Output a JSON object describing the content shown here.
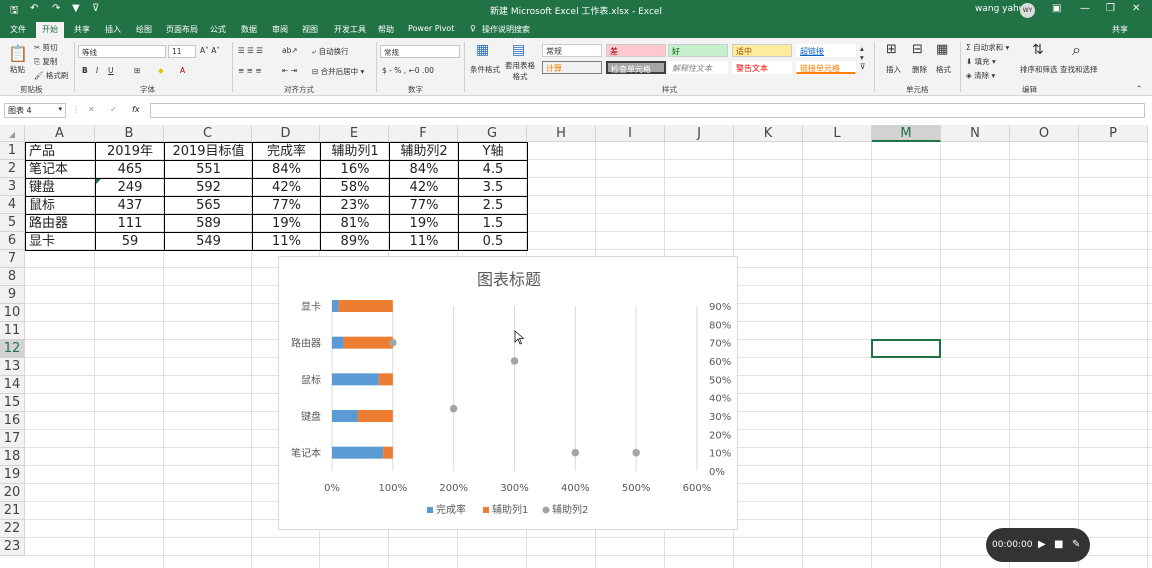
{
  "window": {
    "title": "新建 Microsoft Excel 工作表.xlsx  -  Excel",
    "user": "wang yahui",
    "avatar": "WY"
  },
  "tabs": [
    "文件",
    "开始",
    "共享",
    "插入",
    "绘图",
    "页面布局",
    "公式",
    "数据",
    "审阅",
    "视图",
    "开发工具",
    "帮助",
    "Power Pivot",
    "操作说明搜索"
  ],
  "share_label": "共享",
  "ribbon": {
    "clipboard": {
      "paste": "粘贴",
      "cut": "剪切",
      "copy": "复制",
      "painter": "格式刷",
      "label": "剪贴板"
    },
    "font": {
      "name": "等线",
      "size": "11",
      "label": "字体"
    },
    "align": {
      "wrap": "自动换行",
      "merge": "合并后居中",
      "label": "对齐方式"
    },
    "number": {
      "format": "常规",
      "label": "数字"
    },
    "styles": {
      "cond": "条件格式",
      "table": "套用表格格式",
      "items": [
        "常规",
        "差",
        "好",
        "适中",
        "超链接",
        "计算",
        "检查单元格",
        "解释性文本",
        "警告文本",
        "链接单元格"
      ],
      "label": "样式"
    },
    "cells": {
      "insert": "插入",
      "delete": "删除",
      "format": "格式",
      "label": "单元格"
    },
    "edit": {
      "autosum": "自动求和",
      "fill": "填充",
      "clear": "清除",
      "sort": "排序和筛选",
      "find": "查找和选择",
      "label": "编辑"
    }
  },
  "namebox": "图表 4",
  "columns": [
    "A",
    "B",
    "C",
    "D",
    "E",
    "F",
    "G",
    "H",
    "I",
    "J",
    "K",
    "L",
    "M",
    "N",
    "O",
    "P"
  ],
  "rows": [
    "1",
    "2",
    "3",
    "4",
    "5",
    "6",
    "7",
    "8",
    "9",
    "10",
    "11",
    "12",
    "13",
    "14",
    "15",
    "16",
    "17",
    "18",
    "19",
    "20",
    "21",
    "22",
    "23"
  ],
  "table": [
    [
      "产品",
      "2019年",
      "2019目标值",
      "完成率",
      "辅助列1",
      "辅助列2",
      "Y轴"
    ],
    [
      "笔记本",
      "465",
      "551",
      "84%",
      "16%",
      "84%",
      "4.5"
    ],
    [
      "键盘",
      "249",
      "592",
      "42%",
      "58%",
      "42%",
      "3.5"
    ],
    [
      "鼠标",
      "437",
      "565",
      "77%",
      "23%",
      "77%",
      "2.5"
    ],
    [
      "路由器",
      "111",
      "589",
      "19%",
      "81%",
      "19%",
      "1.5"
    ],
    [
      "显卡",
      "59",
      "549",
      "11%",
      "89%",
      "11%",
      "0.5"
    ]
  ],
  "chart_data": {
    "type": "bar",
    "title": "图表标题",
    "categories": [
      "笔记本",
      "键盘",
      "鼠标",
      "路由器",
      "显卡"
    ],
    "series": [
      {
        "name": "完成率",
        "values": [
          84,
          42,
          77,
          19,
          11
        ],
        "color": "#5b9bd5"
      },
      {
        "name": "辅助列1",
        "values": [
          16,
          58,
          23,
          81,
          89
        ],
        "color": "#ed7d31"
      }
    ],
    "scatter": {
      "name": "辅助列2",
      "x": [
        500,
        400,
        200,
        300,
        100
      ],
      "y": [
        0.5,
        0.5,
        1.7,
        3.0,
        3.5
      ],
      "color": "#a5a5a5"
    },
    "x_ticks": [
      "0%",
      "100%",
      "200%",
      "300%",
      "400%",
      "500%",
      "600%"
    ],
    "y2_ticks": [
      "0%",
      "10%",
      "20%",
      "30%",
      "40%",
      "50%",
      "60%",
      "70%",
      "80%",
      "90%"
    ],
    "xlim": [
      0,
      600
    ],
    "legend": "bottom"
  },
  "recorder": {
    "time": "00:00:00"
  }
}
